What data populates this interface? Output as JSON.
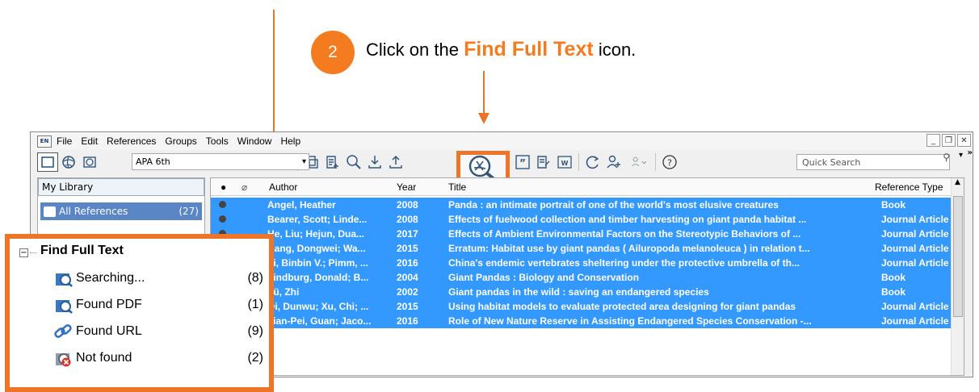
{
  "instruction": {
    "step": "2",
    "before": "Click on the ",
    "highlight": "Find Full Text",
    "after": " icon."
  },
  "colors": {
    "accent": "#ee7427",
    "selection": "#3399ff",
    "group_selected": "#5a86c5"
  },
  "menu": {
    "logo": "EN",
    "items": [
      "File",
      "Edit",
      "References",
      "Groups",
      "Tools",
      "Window",
      "Help"
    ]
  },
  "toolbar": {
    "style": "APA 6th",
    "quick_search_placeholder": "Quick Search",
    "overflow": "»"
  },
  "groups": {
    "header": "My Library",
    "selected_label": "All References",
    "selected_count": "(27)"
  },
  "references": {
    "columns": [
      "Author",
      "Year",
      "Title",
      "Reference Type"
    ],
    "rows": [
      {
        "author": "Angel, Heather",
        "year": "2008",
        "title": "Panda : an intimate portrait of one of the world's most elusive creatures",
        "type": "Book"
      },
      {
        "author": "Bearer, Scott; Linde...",
        "year": "2008",
        "title": "Effects of fuelwood collection and timber harvesting on giant panda habitat ...",
        "type": "Journal Article"
      },
      {
        "author": "He, Liu; Hejun, Dua...",
        "year": "2017",
        "title": "Effects of Ambient Environmental Factors on the Stereotypic Behaviors of ...",
        "type": "Journal Article"
      },
      {
        "author": "Kang, Dongwei; Wa...",
        "year": "2015",
        "title": "Erratum: Habitat use by giant pandas ( Ailuropoda melanoleuca ) in relation t...",
        "type": "Journal Article"
      },
      {
        "author": "Li, Binbin V.; Pimm, ...",
        "year": "2016",
        "title": "China's endemic vertebrates sheltering under the protective umbrella of th...",
        "type": "Journal Article"
      },
      {
        "author": "Lindburg, Donald; B...",
        "year": "2004",
        "title": "Giant Pandas : Biology and Conservation",
        "type": "Book"
      },
      {
        "author": "Lü, Zhi",
        "year": "2002",
        "title": "Giant pandas in the wild : saving an endangered species",
        "type": "Book"
      },
      {
        "author": "Qi, Dunwu; Xu, Chi; ...",
        "year": "2015",
        "title": "Using habitat models to evaluate protected area designing for giant pandas",
        "type": "Journal Article"
      },
      {
        "author": "Tian-Pei, Guan; Jaco...",
        "year": "2016",
        "title": "Role of New Nature Reserve in Assisting Endangered Species Conservation -...",
        "type": "Journal Article"
      }
    ]
  },
  "find_full_text": {
    "title": "Find Full Text",
    "items": [
      {
        "label": "Searching...",
        "count": "(8)",
        "icon": "searching-icon"
      },
      {
        "label": "Found PDF",
        "count": "(1)",
        "icon": "found-pdf-icon"
      },
      {
        "label": "Found URL",
        "count": "(9)",
        "icon": "link-icon"
      },
      {
        "label": "Not found",
        "count": "(2)",
        "icon": "not-found-icon"
      }
    ]
  }
}
